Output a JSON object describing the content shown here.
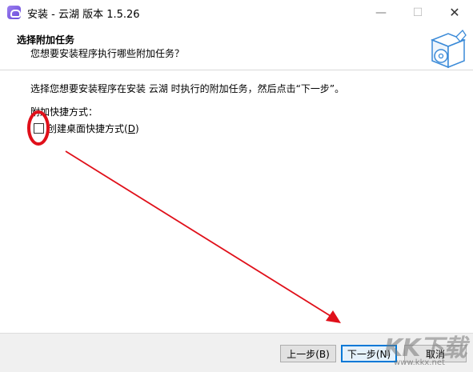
{
  "window": {
    "title": "安装 - 云湖 版本 1.5.26",
    "minimize_glyph": "—",
    "maximize_glyph": "☐",
    "close_glyph": "✕",
    "icon": "app-icon"
  },
  "header": {
    "title": "选择附加任务",
    "subtitle": "您想要安装程序执行哪些附加任务？",
    "graphic_icon": "install-box-icon"
  },
  "body": {
    "description": "选择您想要安装程序在安装 云湖 时执行的附加任务，然后点击“下一步”。",
    "group_label": "附加快捷方式：",
    "checkbox": {
      "label_prefix": "创建桌面快捷方式(",
      "label_accel": "D",
      "label_suffix": ")",
      "checked": false
    }
  },
  "footer": {
    "back_label": "上一步(B)",
    "next_label": "下一步(N)",
    "cancel_label": "取消"
  },
  "annotations": {
    "color": "#e0101a"
  },
  "watermark": {
    "logo_text": "KK下载",
    "url": "www.kkx.net"
  }
}
